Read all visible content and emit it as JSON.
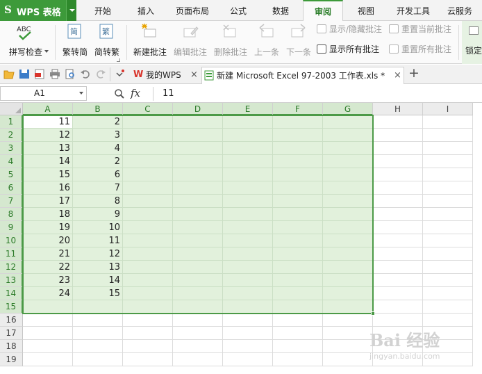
{
  "app": {
    "title": "WPS 表格",
    "logo": "S"
  },
  "menu": {
    "tabs": [
      "开始",
      "插入",
      "页面布局",
      "公式",
      "数据",
      "审阅",
      "视图",
      "开发工具",
      "云服务"
    ],
    "active": "审阅"
  },
  "ribbon": {
    "spellcheck": "拼写检查",
    "trad_to_simp": "繁转简",
    "simp_to_trad": "简转繁",
    "trad_glyph": "简",
    "simp_glyph": "繁",
    "new_comment": "新建批注",
    "edit_comment": "编辑批注",
    "delete_comment": "删除批注",
    "prev": "上一条",
    "next": "下一条",
    "show_hide_comment": "显示/隐藏批注",
    "reset_current_comment": "重置当前批注",
    "show_all_comments": "显示所有批注",
    "reset_all_comments": "重置所有批注",
    "lock": "锁定"
  },
  "doc_tabs": [
    {
      "label": "我的WPS",
      "close": "×"
    },
    {
      "label": "新建 Microsoft Excel 97-2003 工作表.xls *",
      "close": "×"
    }
  ],
  "new_tab": "+",
  "formula_bar": {
    "name_box": "A1",
    "fx": "fx",
    "value": "11"
  },
  "sheet": {
    "columns": [
      "A",
      "B",
      "C",
      "D",
      "E",
      "F",
      "G",
      "H",
      "I"
    ],
    "rows": [
      "1",
      "2",
      "3",
      "4",
      "5",
      "6",
      "7",
      "8",
      "9",
      "10",
      "11",
      "12",
      "13",
      "14",
      "15",
      "16",
      "17",
      "18",
      "19"
    ],
    "col_a": [
      "11",
      "12",
      "13",
      "14",
      "15",
      "16",
      "17",
      "18",
      "19",
      "20",
      "21",
      "22",
      "23",
      "24"
    ],
    "col_b": [
      "2",
      "3",
      "4",
      "2",
      "6",
      "7",
      "8",
      "9",
      "10",
      "11",
      "12",
      "13",
      "14",
      "15"
    ],
    "selection": "A1:G15"
  },
  "watermark": {
    "brand": "Bai 经验",
    "url": "jingyan.baidu.com"
  },
  "colors": {
    "accent": "#3d9a3a",
    "selection_fill": "#e2f1dc",
    "selection_border": "#4c9a47"
  }
}
